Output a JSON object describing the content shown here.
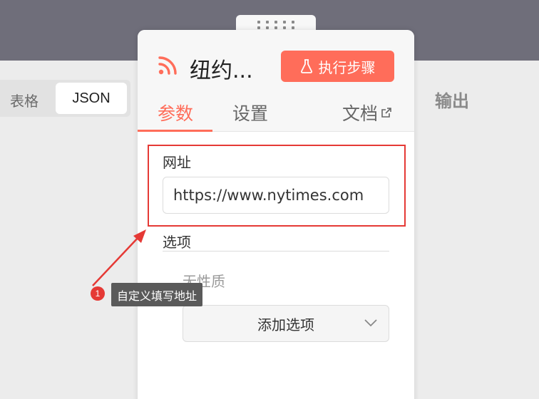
{
  "background": {
    "topbar_color": "#6f6e7a",
    "canvas_color": "#ececec"
  },
  "view_toggle": {
    "table_label": "表格",
    "json_label": "JSON"
  },
  "output_panel": {
    "title": "输出"
  },
  "node": {
    "icon": "rss-icon",
    "title": "纽约...",
    "execute_button": {
      "label": "执行步骤",
      "icon": "flask-icon",
      "color": "#ff6d5a"
    },
    "tabs": [
      {
        "label": "参数",
        "active": true
      },
      {
        "label": "设置",
        "active": false
      },
      {
        "label": "文档",
        "active": false,
        "icon": "external-link-icon"
      }
    ]
  },
  "params": {
    "url": {
      "label": "网址",
      "value": "https://www.nytimes.com"
    },
    "options": {
      "label": "选项",
      "empty_text": "无性质",
      "add_button": {
        "label": "添加选项",
        "icon": "chevron-down-icon"
      }
    }
  },
  "annotation": {
    "step": "1",
    "text": "自定义填写地址",
    "color": "#e53935"
  }
}
